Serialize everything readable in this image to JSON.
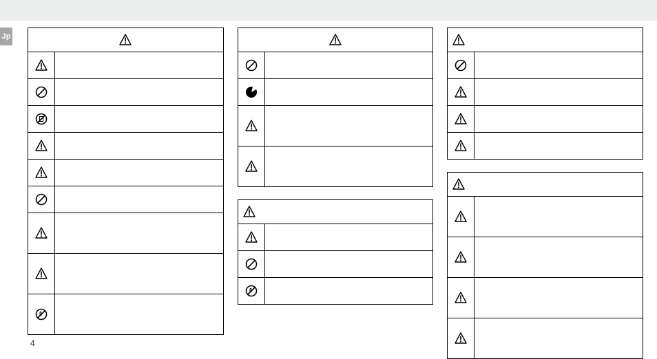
{
  "page_number": "4",
  "language_tab": "Jp",
  "columns": [
    {
      "boxes": [
        {
          "header": {
            "centered": true,
            "icon": "warning"
          },
          "rows": [
            {
              "icon": "warning",
              "h": "h1",
              "text": ""
            },
            {
              "icon": "prohibit",
              "h": "h1",
              "text": ""
            },
            {
              "icon": "prohibit-disassemble",
              "h": "h1",
              "text": ""
            },
            {
              "icon": "warning",
              "h": "h1",
              "text": ""
            },
            {
              "icon": "warning",
              "h": "h1",
              "text": ""
            },
            {
              "icon": "prohibit",
              "h": "h1",
              "text": ""
            },
            {
              "icon": "warning",
              "h": "h2",
              "text": ""
            },
            {
              "icon": "warning",
              "h": "h2",
              "text": ""
            },
            {
              "icon": "prohibit-touch",
              "h": "h2",
              "text": ""
            }
          ]
        }
      ]
    },
    {
      "boxes": [
        {
          "header": {
            "centered": true,
            "icon": "warning"
          },
          "rows": [
            {
              "icon": "prohibit",
              "h": "h1",
              "text": ""
            },
            {
              "icon": "filled-circle-notch",
              "h": "h1",
              "text": ""
            },
            {
              "icon": "warning",
              "h": "h2",
              "text": ""
            },
            {
              "icon": "warning",
              "h": "h2",
              "text": ""
            }
          ]
        },
        {
          "header": {
            "centered": false,
            "icon": "warning"
          },
          "rows": [
            {
              "icon": "warning",
              "h": "h1",
              "text": ""
            },
            {
              "icon": "prohibit",
              "h": "h1",
              "text": ""
            },
            {
              "icon": "prohibit-touch",
              "h": "h1",
              "text": ""
            }
          ]
        }
      ]
    },
    {
      "boxes": [
        {
          "header": {
            "centered": false,
            "icon": "warning"
          },
          "rows": [
            {
              "icon": "prohibit",
              "h": "h1",
              "text": ""
            },
            {
              "icon": "warning",
              "h": "h1",
              "text": ""
            },
            {
              "icon": "warning",
              "h": "h1",
              "text": ""
            },
            {
              "icon": "warning",
              "h": "h1",
              "text": ""
            }
          ]
        },
        {
          "header": {
            "centered": false,
            "icon": "warning"
          },
          "rows": [
            {
              "icon": "warning",
              "h": "h2",
              "text": ""
            },
            {
              "icon": "warning",
              "h": "h2",
              "text": ""
            },
            {
              "icon": "warning",
              "h": "h2",
              "text": ""
            },
            {
              "icon": "warning",
              "h": "h2",
              "text": ""
            }
          ]
        }
      ]
    }
  ]
}
